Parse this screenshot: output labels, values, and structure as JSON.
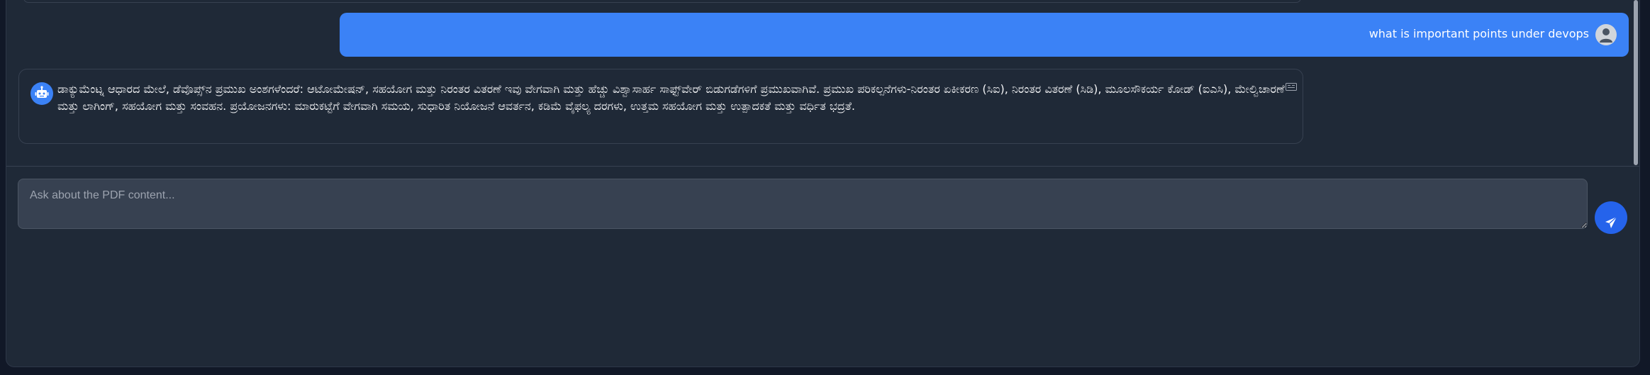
{
  "chat": {
    "user_message": "what is important points under devops",
    "bot_message": "ಡಾಕ್ಯುಮೆಂಟ್ನ ಆಧಾರದ ಮೇಲೆ, ಡೆವೊಪ್ಸ್‌ನ ಪ್ರಮುಖ ಅಂಶಗಳೆಂದರೆ: ಆಟೋಮೇಷನ್, ಸಹಯೋಗ ಮತ್ತು ನಿರಂತರ ವಿತರಣೆ ಇವು ವೇಗವಾಗಿ ಮತ್ತು ಹೆಚ್ಚು ವಿಶ್ವಾಸಾರ್ಹ ಸಾಫ್ಟ್‌ವೇರ್ ಬಿಡುಗಡೆಗಳಿಗೆ ಪ್ರಮುಖವಾಗಿವೆ. ಪ್ರಮುಖ ಪರಿಕಲ್ಪನೆಗಳು-ನಿರಂತರ ಏಕೀಕರಣ (ಸಿಐ), ನಿರಂತರ ವಿತರಣೆ (ಸಿಡಿ), ಮೂಲಸೌಕರ್ಯ ಕೋಡ್ (ಐಎಸಿ), ಮೇಲ್ವಿಚಾರಣೆ ಮತ್ತು ಲಾಗಿಂಗ್, ಸಹಯೋಗ ಮತ್ತು ಸಂವಹನ. ಪ್ರಯೋಜನಗಳು: ಮಾರುಕಟ್ಟೆಗೆ ವೇಗವಾಗಿ ಸಮಯ, ಸುಧಾರಿತ ನಿಯೋಜನೆ ಆವರ್ತನ, ಕಡಿಮೆ ವೈಫಲ್ಯ ದರಗಳು, ಉತ್ತಮ ಸಹಯೋಗ ಮತ್ತು ಉತ್ಪಾದಕತೆ ಮತ್ತು ವರ್ಧಿತ ಭದ್ರತೆ."
  },
  "input": {
    "placeholder": "Ask about the PDF content...",
    "value": ""
  },
  "icons": {
    "user_avatar": "user-icon",
    "bot_avatar": "robot-icon",
    "copy": "copy-icon",
    "send": "paper-plane-icon"
  },
  "colors": {
    "user_bubble": "#3b82f6",
    "send_button": "#2563eb",
    "background": "#1f2937"
  }
}
